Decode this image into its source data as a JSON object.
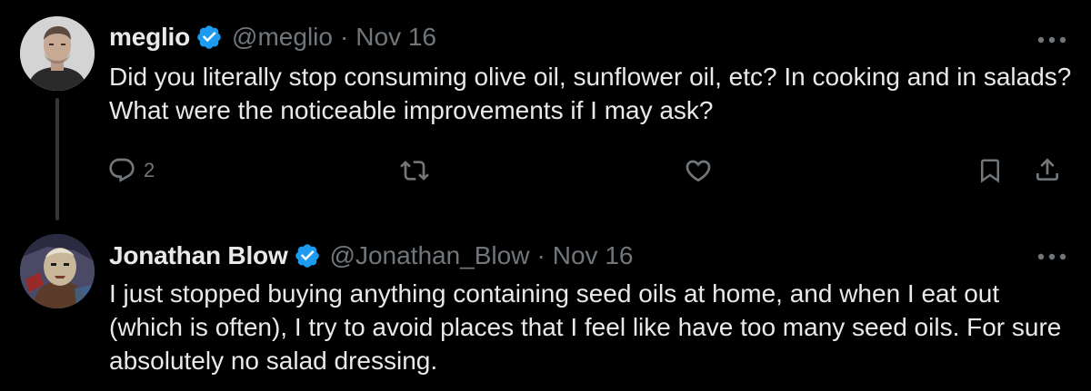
{
  "tweets": [
    {
      "display_name": "meglio",
      "handle": "@meglio",
      "separator": "·",
      "date": "Nov 16",
      "text": "Did you literally stop consuming olive oil, sunflower oil, etc? In cooking and in salads? What were the noticeable improvements if I may ask?",
      "reply_count": "2",
      "verified": true
    },
    {
      "display_name": "Jonathan Blow",
      "handle": "@Jonathan_Blow",
      "separator": "·",
      "date": "Nov 16",
      "text": "I just stopped buying anything containing seed oils at home, and when I eat out (which is often), I try to avoid places that I feel like have too many seed oils. For sure absolutely no salad dressing.",
      "verified": true
    }
  ],
  "colors": {
    "background": "#000000",
    "primary_text": "#e7e9ea",
    "secondary_text": "#71767b",
    "verified_badge": "#1d9bf0",
    "thread_line": "#333639"
  }
}
